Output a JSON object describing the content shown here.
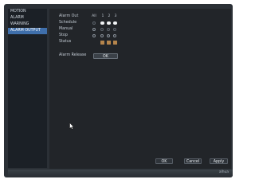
{
  "sidebar": {
    "items": [
      {
        "label": "MOTION",
        "active": false
      },
      {
        "label": "ALARM",
        "active": false
      },
      {
        "label": "WARNING",
        "active": false
      },
      {
        "label": "ALARM OUTPUT",
        "active": true
      }
    ]
  },
  "alarm_output": {
    "header_label": "Alarm Out",
    "columns": [
      "All",
      "1",
      "2",
      "3"
    ],
    "rows": [
      {
        "label": "Schedule",
        "all": "off",
        "ch": [
          "on",
          "on",
          "on"
        ]
      },
      {
        "label": "Manual",
        "all": "off",
        "ch": [
          "off",
          "off",
          "off"
        ]
      },
      {
        "label": "Stop",
        "all": "off",
        "ch": [
          "off",
          "off",
          "off"
        ]
      },
      {
        "label": "Status"
      }
    ],
    "status_color": "#b5854c",
    "alarm_release_label": "Alarm Release",
    "alarm_release_button": "OK"
  },
  "footer": {
    "ok": "OK",
    "cancel": "Cancel",
    "apply": "Apply"
  },
  "brand": "alhua",
  "colors": {
    "accent": "#3f6fab",
    "background": "#2b3036",
    "panel": "#222529"
  }
}
